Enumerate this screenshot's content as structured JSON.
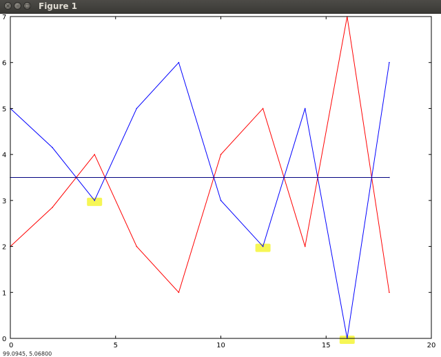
{
  "window": {
    "title": "Figure 1",
    "close_glyph": "×",
    "minimize_glyph": "–",
    "maximize_glyph": "□",
    "status": "99.0945, 5.06800"
  },
  "chart_data": {
    "type": "line",
    "xlim": [
      0,
      20
    ],
    "ylim": [
      0,
      7
    ],
    "x_ticks": [
      0,
      5,
      10,
      15,
      20
    ],
    "y_ticks": [
      0,
      1,
      2,
      3,
      4,
      5,
      6,
      7
    ],
    "grid": false,
    "series": [
      {
        "color": "#ff0000",
        "x": [
          0,
          2,
          4,
          6,
          8,
          10,
          12,
          14,
          16,
          18
        ],
        "y": [
          2,
          2.85,
          4,
          2,
          1,
          4,
          5,
          2,
          7,
          1
        ]
      },
      {
        "color": "#0000ff",
        "x": [
          0,
          2,
          4,
          6,
          8,
          10,
          12,
          14,
          16,
          18
        ],
        "y": [
          5,
          4.15,
          3,
          5,
          6,
          3,
          2,
          5,
          0,
          6
        ]
      },
      {
        "color": "#000080",
        "x": [
          0,
          18
        ],
        "y": [
          3.5,
          3.5
        ]
      }
    ],
    "highlights": [
      {
        "x": 4,
        "y": 3,
        "color": "#f5f542"
      },
      {
        "x": 12,
        "y": 2,
        "color": "#f5f542"
      },
      {
        "x": 16,
        "y": 0,
        "color": "#f5f542"
      }
    ]
  }
}
